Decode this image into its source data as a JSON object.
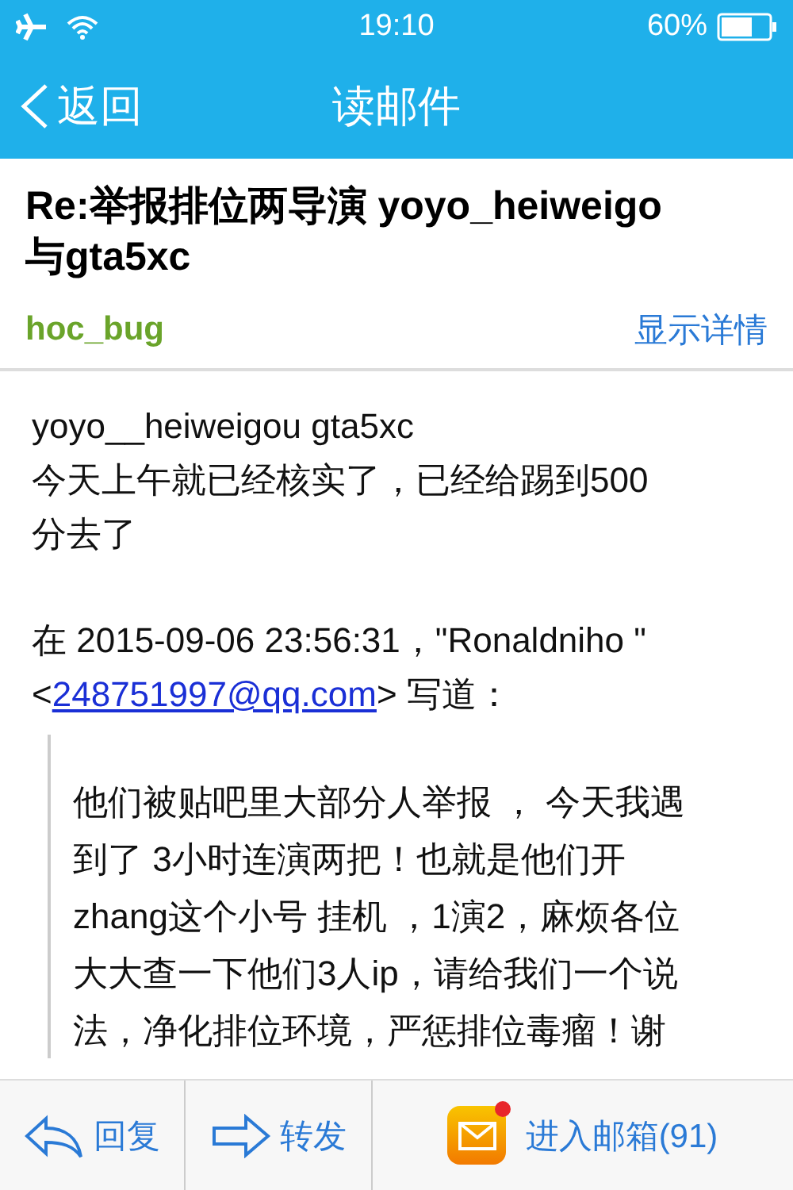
{
  "status_bar": {
    "time": "19:10",
    "battery": "60%"
  },
  "nav": {
    "back": "返回",
    "title": "读邮件"
  },
  "header": {
    "subject": "Re:举报排位两导演 yoyo_heiweigo 与gta5xc",
    "sender": "hoc_bug",
    "details": "显示详情"
  },
  "body": {
    "lines": [
      "yoyo__heiweigou gta5xc",
      "今天上午就已经核实了，已经给踢到500分去了"
    ],
    "quote_header": {
      "line_1": "在 2015-09-06 23:56:31，\"Ronaldniho \"",
      "before_link": "<",
      "email": "248751997@qq.com",
      "after_link": "> 写道："
    },
    "quote_lines": [
      "他们被贴吧里大部分人举报 ， 今天我遇",
      "到了 3小时连演两把！也就是他们开",
      "zhang这个小号 挂机 ，1演2，麻烦各位",
      "大大查一下他们3人ip，请给我们一个说",
      "法，净化排位环境，严惩排位毒瘤！谢"
    ]
  },
  "toolbar": [
    {
      "kind": "reply",
      "label": "回复"
    },
    {
      "kind": "forward",
      "label": "转发"
    },
    {
      "kind": "inbox",
      "label": "进入邮箱(91)",
      "unread": true
    }
  ]
}
